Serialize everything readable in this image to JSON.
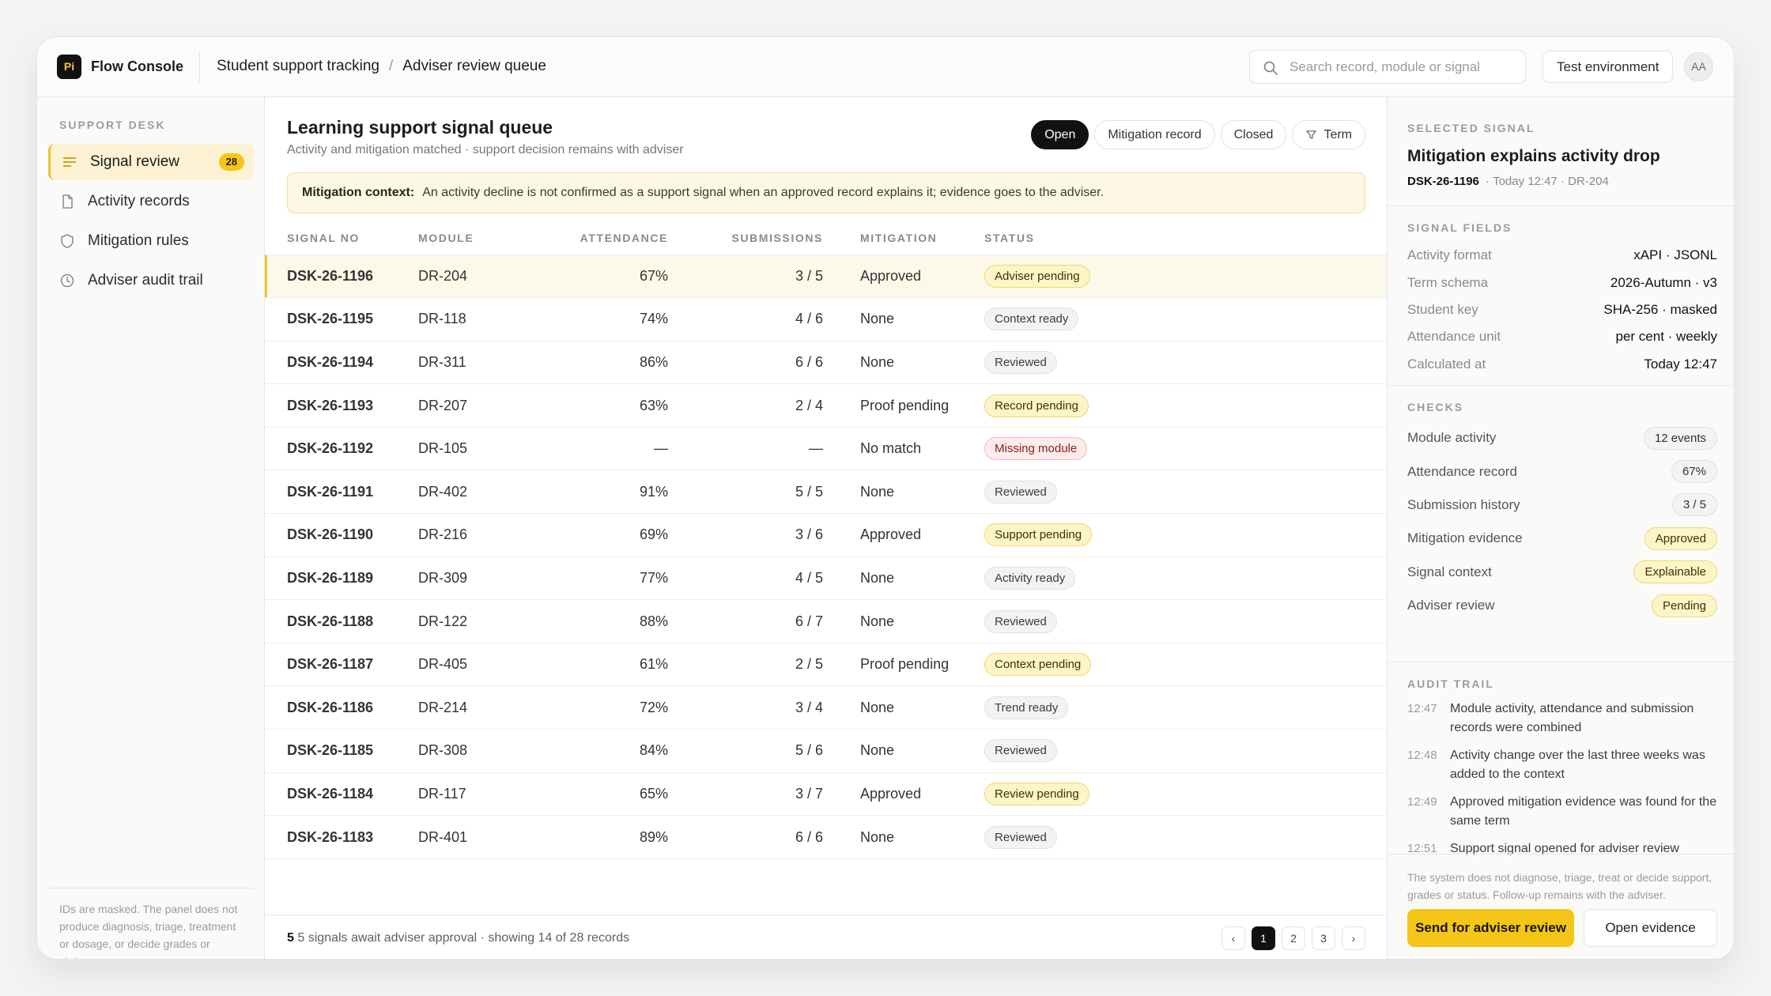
{
  "app": {
    "logo": "Pi",
    "name": "Flow Console"
  },
  "breadcrumb": [
    "Student support tracking",
    "Adviser review queue"
  ],
  "search": {
    "placeholder": "Search record, module or signal",
    "value": ""
  },
  "environment_label": "Test environment",
  "avatar": "AA",
  "sidebar": {
    "section": "SUPPORT DESK",
    "items": [
      {
        "label": "Signal review",
        "badge": "28",
        "icon": "list-icon",
        "active": true
      },
      {
        "label": "Activity records",
        "icon": "document-icon"
      },
      {
        "label": "Mitigation rules",
        "icon": "shield-icon"
      },
      {
        "label": "Adviser audit trail",
        "icon": "clock-icon"
      }
    ],
    "note": "IDs are masked. The panel does not produce diagnosis, triage, treatment or dosage, or decide grades or status."
  },
  "main": {
    "title": "Learning support signal queue",
    "subtitle": "Activity and mitigation matched · support decision remains with adviser",
    "filters": [
      "Open",
      "Mitigation record",
      "Closed",
      "Term"
    ],
    "active_filter": "Open",
    "context_label": "Mitigation context:",
    "context_text": "An activity decline is not confirmed as a support signal when an approved record explains it; evidence goes to the adviser.",
    "columns": [
      "SIGNAL NO",
      "MODULE",
      "ATTENDANCE",
      "SUBMISSIONS",
      "MITIGATION",
      "STATUS"
    ],
    "rows": [
      {
        "id": "DSK-26-1196",
        "module": "DR-204",
        "attendance": "67%",
        "submissions": "3 / 5",
        "mitigation": "Approved",
        "status": "Adviser pending",
        "tone": "warn",
        "selected": true
      },
      {
        "id": "DSK-26-1195",
        "module": "DR-118",
        "attendance": "74%",
        "submissions": "4 / 6",
        "mitigation": "None",
        "status": "Context ready",
        "tone": "neutral"
      },
      {
        "id": "DSK-26-1194",
        "module": "DR-311",
        "attendance": "86%",
        "submissions": "6 / 6",
        "mitigation": "None",
        "status": "Reviewed",
        "tone": "neutral"
      },
      {
        "id": "DSK-26-1193",
        "module": "DR-207",
        "attendance": "63%",
        "submissions": "2 / 4",
        "mitigation": "Proof pending",
        "status": "Record pending",
        "tone": "warn"
      },
      {
        "id": "DSK-26-1192",
        "module": "DR-105",
        "attendance": "—",
        "submissions": "—",
        "mitigation": "No match",
        "status": "Missing module",
        "tone": "danger"
      },
      {
        "id": "DSK-26-1191",
        "module": "DR-402",
        "attendance": "91%",
        "submissions": "5 / 5",
        "mitigation": "None",
        "status": "Reviewed",
        "tone": "neutral"
      },
      {
        "id": "DSK-26-1190",
        "module": "DR-216",
        "attendance": "69%",
        "submissions": "3 / 6",
        "mitigation": "Approved",
        "status": "Support pending",
        "tone": "warn"
      },
      {
        "id": "DSK-26-1189",
        "module": "DR-309",
        "attendance": "77%",
        "submissions": "4 / 5",
        "mitigation": "None",
        "status": "Activity ready",
        "tone": "neutral"
      },
      {
        "id": "DSK-26-1188",
        "module": "DR-122",
        "attendance": "88%",
        "submissions": "6 / 7",
        "mitigation": "None",
        "status": "Reviewed",
        "tone": "neutral"
      },
      {
        "id": "DSK-26-1187",
        "module": "DR-405",
        "attendance": "61%",
        "submissions": "2 / 5",
        "mitigation": "Proof pending",
        "status": "Context pending",
        "tone": "warn"
      },
      {
        "id": "DSK-26-1186",
        "module": "DR-214",
        "attendance": "72%",
        "submissions": "3 / 4",
        "mitigation": "None",
        "status": "Trend ready",
        "tone": "neutral"
      },
      {
        "id": "DSK-26-1185",
        "module": "DR-308",
        "attendance": "84%",
        "submissions": "5 / 6",
        "mitigation": "None",
        "status": "Reviewed",
        "tone": "neutral"
      },
      {
        "id": "DSK-26-1184",
        "module": "DR-117",
        "attendance": "65%",
        "submissions": "3 / 7",
        "mitigation": "Approved",
        "status": "Review pending",
        "tone": "warn"
      },
      {
        "id": "DSK-26-1183",
        "module": "DR-401",
        "attendance": "89%",
        "submissions": "6 / 6",
        "mitigation": "None",
        "status": "Reviewed",
        "tone": "neutral"
      }
    ],
    "footer_count": "5",
    "footer_text": "5 signals await adviser approval · showing 14 of 28 records",
    "pages": [
      "‹",
      "1",
      "2",
      "3",
      "›"
    ],
    "current_page": "1"
  },
  "panel": {
    "section": "SELECTED SIGNAL",
    "title": "Mitigation explains activity drop",
    "signal_id": "DSK-26-1196",
    "meta": "Today 12:47 · DR-204",
    "fields_label": "SIGNAL FIELDS",
    "fields": [
      {
        "k": "Activity format",
        "v": "xAPI · JSONL"
      },
      {
        "k": "Term schema",
        "v": "2026-Autumn · v3"
      },
      {
        "k": "Student key",
        "v": "SHA-256 · masked"
      },
      {
        "k": "Attendance unit",
        "v": "per cent · weekly"
      },
      {
        "k": "Calculated at",
        "v": "Today 12:47"
      }
    ],
    "checks_label": "CHECKS",
    "checks": [
      {
        "k": "Module activity",
        "v": "12 events",
        "tone": "neutral"
      },
      {
        "k": "Attendance record",
        "v": "67%",
        "tone": "neutral"
      },
      {
        "k": "Submission history",
        "v": "3 / 5",
        "tone": "neutral"
      },
      {
        "k": "Mitigation evidence",
        "v": "Approved",
        "tone": "warn"
      },
      {
        "k": "Signal context",
        "v": "Explainable",
        "tone": "warn"
      },
      {
        "k": "Adviser review",
        "v": "Pending",
        "tone": "warn"
      }
    ],
    "audit_label": "AUDIT TRAIL",
    "audit": [
      {
        "t": "12:47",
        "text": "Module activity, attendance and submission records were combined"
      },
      {
        "t": "12:48",
        "text": "Activity change over the last three weeks was added to the context"
      },
      {
        "t": "12:49",
        "text": "Approved mitigation evidence was found for the same term"
      },
      {
        "t": "12:51",
        "text": "Support signal opened for adviser review"
      }
    ],
    "disclaimer": "The system does not diagnose, triage, treat or decide support, grades or status. Follow-up remains with the adviser.",
    "primary_action": "Send for adviser review",
    "secondary_action": "Open evidence"
  }
}
